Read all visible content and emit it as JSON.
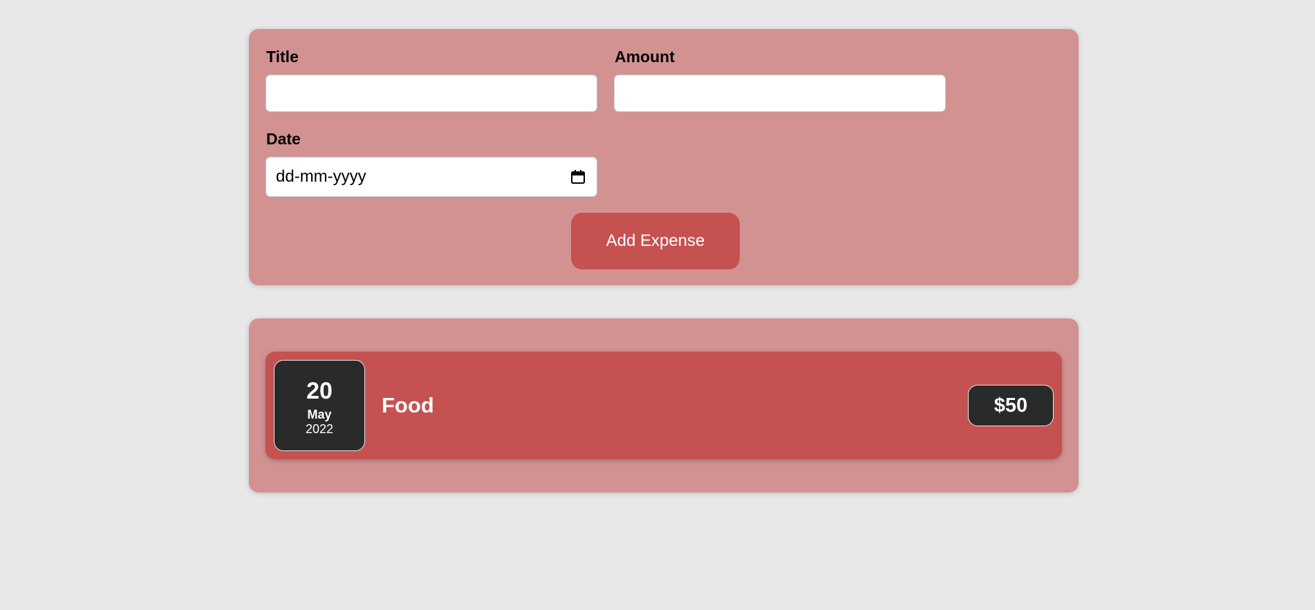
{
  "form": {
    "title_label": "Title",
    "title_value": "",
    "amount_label": "Amount",
    "amount_value": "",
    "date_label": "Date",
    "date_placeholder": "dd-mm-yyyy",
    "date_icon": "calendar-icon",
    "submit_label": "Add Expense"
  },
  "expenses": [
    {
      "day": "20",
      "month": "May",
      "year": "2022",
      "title": "Food",
      "amount": "$50"
    }
  ],
  "colors": {
    "page_background": "#e8e8e8",
    "card_background": "#d39292",
    "accent": "#c55151",
    "badge_background": "#2a2a2a"
  }
}
